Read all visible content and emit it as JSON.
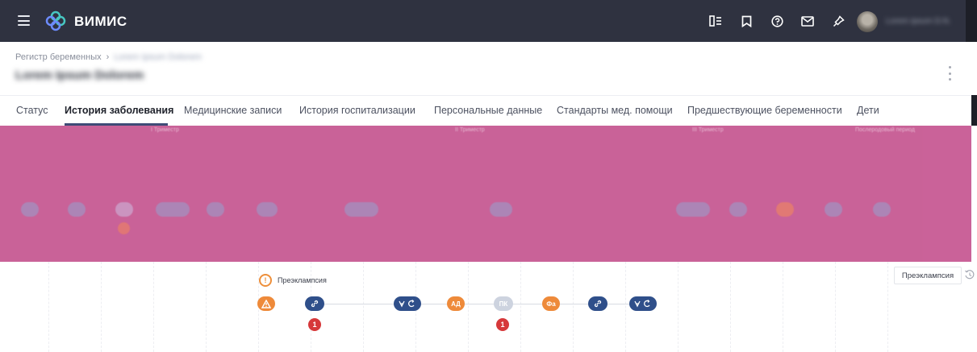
{
  "app": {
    "name": "ВИМИС"
  },
  "topbar": {
    "icons": [
      "panel-icon",
      "bookmark-icon",
      "help-icon",
      "mail-icon",
      "pin-icon"
    ],
    "user_name": "Lorem ipsum D.N."
  },
  "header": {
    "breadcrumb_root": "Регистр беременных",
    "breadcrumb_current": "Lorem Ipsum Dolorem",
    "patient_name": "Lorem Ipsum Dolorem"
  },
  "tabs": [
    {
      "label": "Статус",
      "active": false
    },
    {
      "label": "История заболевания",
      "active": true
    },
    {
      "label": "Медицинские записи",
      "active": false
    },
    {
      "label": "История госпитализации",
      "active": false
    },
    {
      "label": "Персональные данные",
      "active": false
    },
    {
      "label": "Стандарты мед. помощи",
      "active": false
    },
    {
      "label": "Предшествующие беременности",
      "active": false
    },
    {
      "label": "Дети",
      "active": false
    }
  ],
  "overlay": {
    "color": "#c75a93",
    "trimesters": [
      "I Триместр",
      "II Триместр",
      "III Триместр",
      "Послеродовый период"
    ]
  },
  "timeline": {
    "legend_label": "Преэклампсия",
    "legend_mark": "!",
    "events": [
      {
        "label": "",
        "icon": "warning-icon"
      },
      {
        "label": "",
        "icon": "link-icon"
      },
      {
        "label": "",
        "icon": "ultrasound-refresh-icon"
      },
      {
        "label": "АД"
      },
      {
        "label": "ПК"
      },
      {
        "label": "Фа"
      },
      {
        "label": "",
        "icon": "link-icon"
      },
      {
        "label": "",
        "icon": "ultrasound-refresh-icon"
      }
    ],
    "counts": [
      "1",
      "1"
    ]
  },
  "side_panel": {
    "button_label": "Преэклампсия"
  }
}
